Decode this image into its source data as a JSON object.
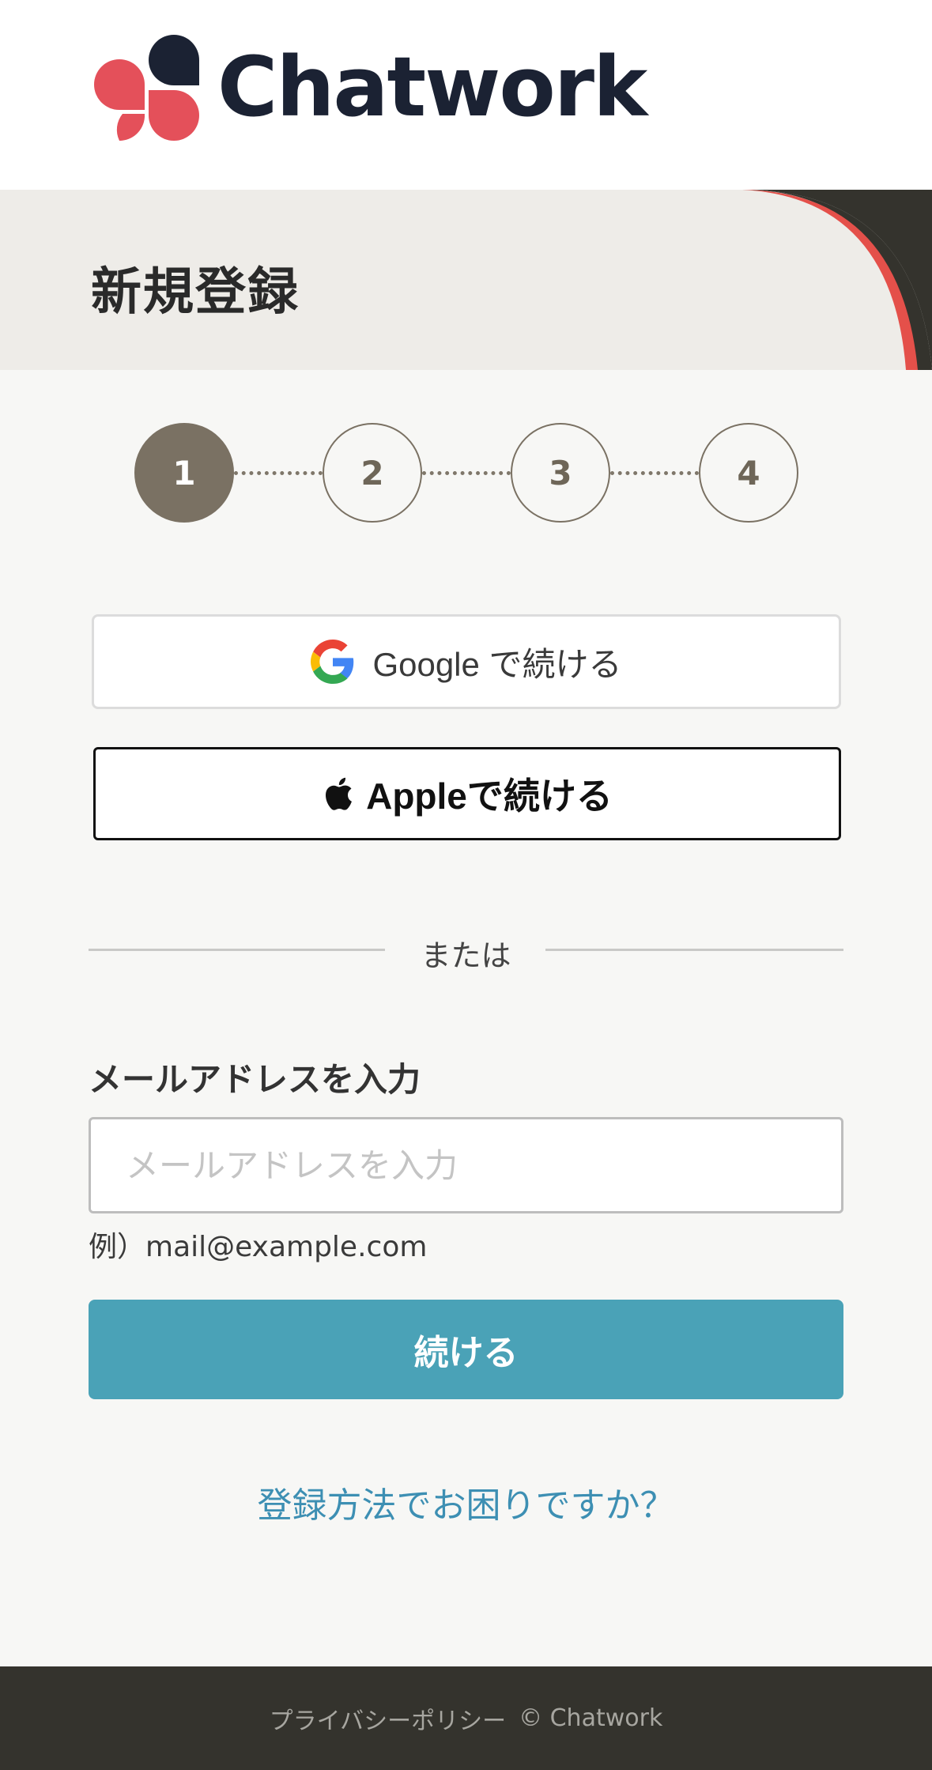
{
  "brand": {
    "name": "Chatwork",
    "logo_colors": {
      "red": "#e4505a",
      "navy": "#1b2233"
    }
  },
  "page": {
    "title": "新規登録"
  },
  "stepper": {
    "current": 1,
    "steps": [
      "1",
      "2",
      "3",
      "4"
    ]
  },
  "social": {
    "google_label": "Google で続ける",
    "apple_label": "Appleで続ける"
  },
  "divider": {
    "text": "または"
  },
  "email": {
    "label": "メールアドレスを入力",
    "placeholder": "メールアドレスを入力",
    "value": "",
    "example": "例）mail@example.com"
  },
  "actions": {
    "continue_label": "続ける",
    "help_link": "登録方法でお困りですか？"
  },
  "footer": {
    "privacy": "プライバシーポリシー",
    "copyright": "© Chatwork"
  },
  "colors": {
    "accent": "#4aa2b7",
    "step_active": "#7a7163",
    "footer_bg": "#34332d"
  }
}
